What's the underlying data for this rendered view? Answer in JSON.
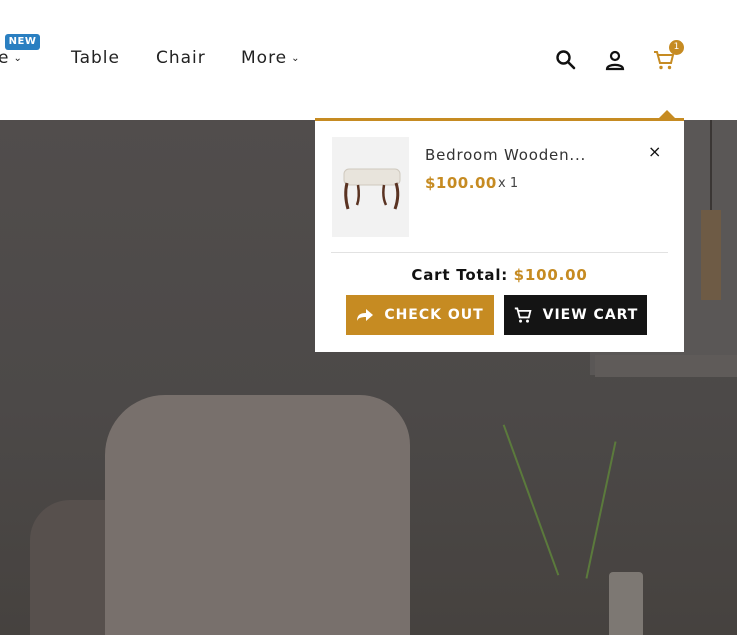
{
  "nav": {
    "items": [
      {
        "label": "e",
        "has_chevron": true
      },
      {
        "label": "Table",
        "has_chevron": false
      },
      {
        "label": "Chair",
        "has_chevron": false
      },
      {
        "label": "More",
        "has_chevron": true
      }
    ],
    "badge_new": "NEW",
    "cart_count": "1"
  },
  "icons": {
    "search": "search-icon",
    "account": "user-icon",
    "cart": "cart-icon",
    "chevron": "chevron-down-icon",
    "remove": "close-icon",
    "checkout": "share-arrow-icon",
    "view_cart": "cart-icon"
  },
  "cart": {
    "item": {
      "name": "Bedroom Wooden...",
      "price": "$100.00",
      "qty": "x 1"
    },
    "remove_label": "×",
    "total_label": "Cart Total:",
    "total_value": "$100.00",
    "checkout_label": "CHECK OUT",
    "view_cart_label": "VIEW CART"
  },
  "colors": {
    "accent": "#c68b22",
    "badge_blue": "#2a7fc1",
    "dark_button": "#141414"
  }
}
